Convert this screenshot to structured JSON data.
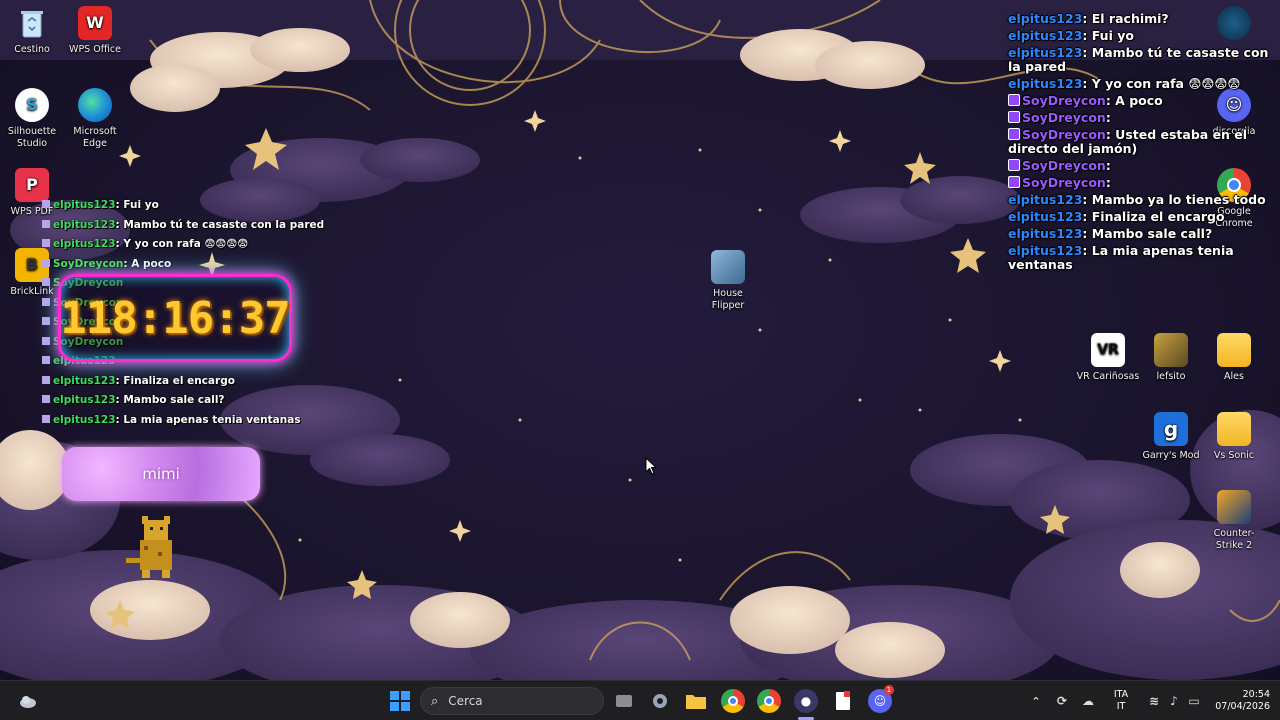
{
  "desktop_icons_left": [
    {
      "label": "Cestino",
      "icon": "recycle-bin-icon"
    },
    {
      "label": "WPS Office",
      "icon": "wps-office-icon"
    },
    {
      "label": "Silhouette Studio",
      "icon": "silhouette-studio-icon"
    },
    {
      "label": "Microsoft Edge",
      "icon": "edge-icon"
    },
    {
      "label": "WPS PDF",
      "icon": "wps-pdf-icon"
    },
    {
      "label": "BrickLink",
      "icon": "bricklink-icon"
    }
  ],
  "desktop_icons_center": [
    {
      "label": "House Flipper",
      "icon": "house-flipper-icon"
    }
  ],
  "desktop_icons_right": [
    {
      "label": "discordia",
      "icon": "discord-icon"
    },
    {
      "label": "Google Chrome",
      "icon": "chrome-icon"
    },
    {
      "label": "VR Cariñosas",
      "icon": "vr-icon"
    },
    {
      "label": "lefsito",
      "icon": "lefsito-icon"
    },
    {
      "label": "Ales",
      "icon": "folder-icon"
    },
    {
      "label": "Garry's Mod",
      "icon": "garrys-mod-icon"
    },
    {
      "label": "Vs Sonic",
      "icon": "folder-icon"
    },
    {
      "label": "Counter-Strike 2",
      "icon": "counter-strike-icon"
    }
  ],
  "chat_right": [
    {
      "user": "elpitus123",
      "badge": false,
      "text": ": El rachimi?"
    },
    {
      "user": "elpitus123",
      "badge": false,
      "text": ": Fui yo"
    },
    {
      "user": "elpitus123",
      "badge": false,
      "text": ": Mambo tú te casaste con la pared"
    },
    {
      "user": "elpitus123",
      "badge": false,
      "text": ": Y yo con rafa 😨😨😨😨"
    },
    {
      "user": "SoyDreycon",
      "badge": true,
      "text": ": A poco"
    },
    {
      "user": "SoyDreycon",
      "badge": true,
      "text": ":"
    },
    {
      "user": "SoyDreycon",
      "badge": true,
      "text": ": Usted estaba en el directo del jamón)"
    },
    {
      "user": "SoyDreycon",
      "badge": true,
      "text": ":"
    },
    {
      "user": "SoyDreycon",
      "badge": true,
      "text": ":"
    },
    {
      "user": "elpitus123",
      "badge": false,
      "text": ": Mambo ya lo tienes todo"
    },
    {
      "user": "elpitus123",
      "badge": false,
      "text": ": Finaliza el encargo"
    },
    {
      "user": "elpitus123",
      "badge": false,
      "text": ": Mambo sale call?"
    },
    {
      "user": "elpitus123",
      "badge": false,
      "text": ": La mia apenas tenia ventanas"
    }
  ],
  "chat_left": [
    {
      "user": "elpitus123",
      "badge": false,
      "text": ": Fui yo"
    },
    {
      "user": "elpitus123",
      "badge": false,
      "text": ": Mambo tú te casaste con la pared"
    },
    {
      "user": "elpitus123",
      "badge": false,
      "text": ": Y yo con rafa 😨😨😨😨"
    },
    {
      "user": "SoyDreycon",
      "badge": true,
      "text": ": A poco"
    },
    {
      "user": "SoyDreycon",
      "badge": true,
      "text": ""
    },
    {
      "user": "SoyDreycon",
      "badge": true,
      "text": ""
    },
    {
      "user": "SoyDreycon",
      "badge": true,
      "text": ""
    },
    {
      "user": "SoyDreycon",
      "badge": true,
      "text": ""
    },
    {
      "user": "elpitus123",
      "badge": false,
      "text": ""
    },
    {
      "user": "elpitus123",
      "badge": false,
      "text": ": Finaliza el encargo"
    },
    {
      "user": "elpitus123",
      "badge": false,
      "text": ": Mambo sale call?"
    },
    {
      "user": "elpitus123",
      "badge": false,
      "text": ": La mia apenas tenia ventanas"
    }
  ],
  "timer": {
    "value": "118:16:37"
  },
  "mimi_widget": {
    "label": "mimi"
  },
  "taskbar": {
    "search_label": "Cerca",
    "language": "ITA",
    "language_sub": "IT",
    "time": "20:54",
    "date": "07/04/2026",
    "discord_badge": "1"
  },
  "colors": {
    "wallpaper_bg": "#1c1630",
    "chat_user_blue": "#2f86ff",
    "chat_user_purple": "#9b59ff",
    "chat_user_green": "#3ddc5a",
    "timer_digits": "#ffc830",
    "timer_glow_pink": "#ff2bd1",
    "timer_glow_cyan": "#6cd4ff"
  }
}
